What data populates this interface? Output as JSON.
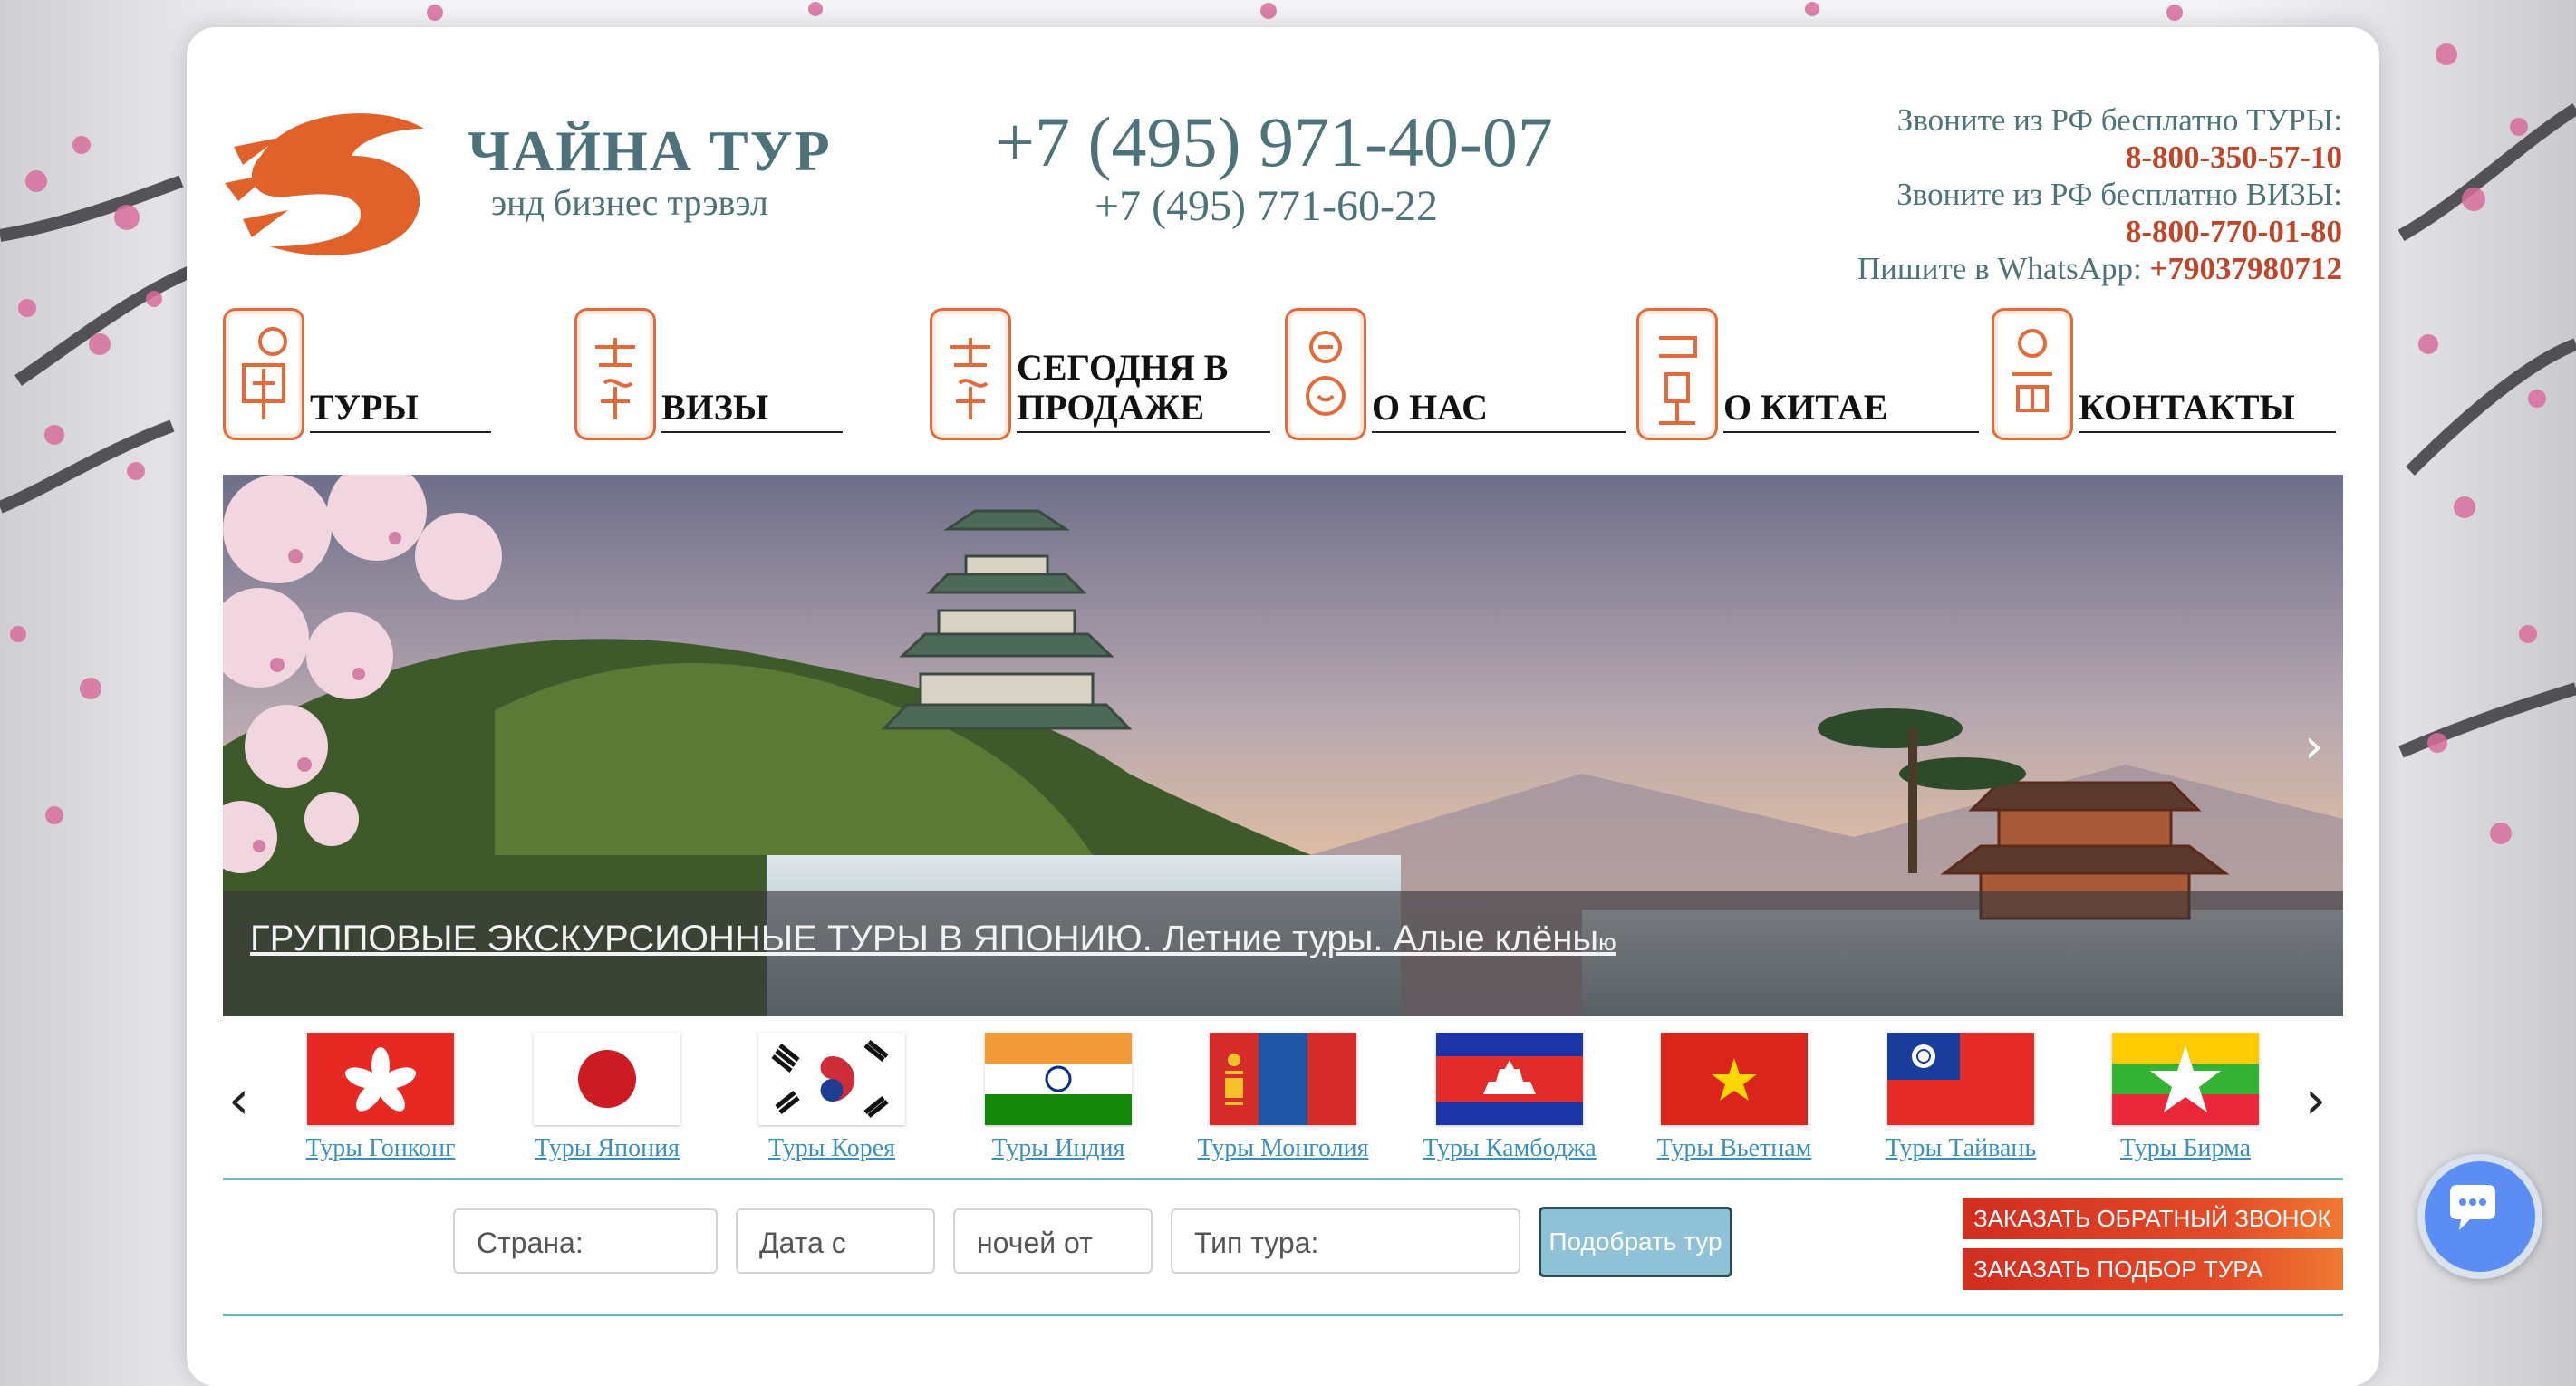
{
  "brand": {
    "title": "ЧАЙНА ТУР",
    "subtitle": "энд бизнес трэвэл"
  },
  "phones": {
    "main": "+7 (495) 971-40-07",
    "second": "+7 (495) 771-60-22"
  },
  "contacts": {
    "tours_label": "Звоните из РФ бесплатно ТУРЫ:",
    "tours_phone": "8-800-350-57-10",
    "visas_label": "Звоните из РФ бесплатно ВИЗЫ:",
    "visas_phone": "8-800-770-01-80",
    "whatsapp_label": "Пишите в WhatsApp:",
    "whatsapp_phone": "+79037980712"
  },
  "nav": [
    {
      "label": "ТУРЫ",
      "icon": "tours-seal-icon"
    },
    {
      "label": "ВИЗЫ",
      "icon": "visas-seal-icon"
    },
    {
      "label": "СЕГОДНЯ В ПРОДАЖЕ",
      "icon": "sale-seal-icon"
    },
    {
      "label": "О НАС",
      "icon": "about-seal-icon"
    },
    {
      "label": "О КИТАЕ",
      "icon": "china-seal-icon"
    },
    {
      "label": "КОНТАКТЫ",
      "icon": "contacts-seal-icon"
    }
  ],
  "slider": {
    "caption": "ГРУППОВЫЕ ЭКСКУРСИОННЫЕ ТУРЫ В ЯПОНИЮ. Летние туры. Алые клёны",
    "caption_tail": "ю",
    "next_icon": "chevron-right-icon"
  },
  "flags": [
    {
      "label": "Туры Гонконг",
      "icon": "hong-kong-flag-icon"
    },
    {
      "label": "Туры Япония",
      "icon": "japan-flag-icon"
    },
    {
      "label": "Туры Корея",
      "icon": "korea-flag-icon"
    },
    {
      "label": "Туры Индия",
      "icon": "india-flag-icon"
    },
    {
      "label": "Туры Монголия",
      "icon": "mongolia-flag-icon"
    },
    {
      "label": "Туры Камбоджа",
      "icon": "cambodia-flag-icon"
    },
    {
      "label": "Туры Вьетнам",
      "icon": "vietnam-flag-icon"
    },
    {
      "label": "Туры Тайвань",
      "icon": "taiwan-flag-icon"
    },
    {
      "label": "Туры Бирма",
      "icon": "burma-flag-icon"
    }
  ],
  "search": {
    "country_placeholder": "Страна:",
    "date_placeholder": "Дата с",
    "nights_placeholder": "ночей от",
    "type_placeholder": "Тип тура:",
    "submit_label": "Подобрать тур"
  },
  "cta": {
    "callback": "ЗАКАЗАТЬ ОБРАТНЫЙ ЗВОНОК",
    "tour_selection": "ЗАКАЗАТЬ ПОДБОР ТУРА"
  },
  "colors": {
    "brand_teal": "#4d7279",
    "accent_red": "#c0462a",
    "link_blue": "#3b8fbf",
    "seal_orange": "#e26a3b"
  }
}
